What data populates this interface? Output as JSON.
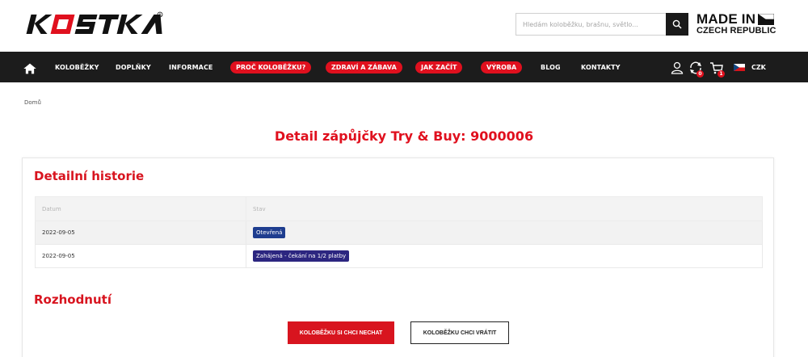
{
  "header": {
    "logo_text": "KOSTKA",
    "search": {
      "placeholder": "Hledám koloběžku, brašnu, světlo..."
    },
    "made_in": {
      "line1": "MADE IN",
      "line2": "CZECH REPUBLIC"
    }
  },
  "nav": {
    "items": [
      "KOLOBĚŽKY",
      "DOPLŇKY",
      "INFORMACE"
    ],
    "pills": [
      "PROČ KOLOBĚŽKU?",
      "ZDRAVÍ A ZÁBAVA",
      "JAK ZAČÍT",
      "VÝROBA"
    ],
    "items2": [
      "BLOG",
      "KONTAKTY"
    ],
    "compare_count": "0",
    "cart_count": "1",
    "currency": "CZK",
    "colors": {
      "bar": "#1c1c1c",
      "pill": "#e0101e"
    }
  },
  "breadcrumb": {
    "home": "Domů"
  },
  "page_title": "Detail zápůjčky Try & Buy: 9000006",
  "history": {
    "title": "Detailní historie",
    "columns": [
      "Datum",
      "Stav"
    ],
    "rows": [
      {
        "date": "2022-09-05",
        "status": "Otevřená"
      },
      {
        "date": "2022-09-05",
        "status": "Zahájená - čekání na 1/2 platby"
      }
    ]
  },
  "decision": {
    "title": "Rozhodnutí",
    "keep_label": "KOLOBĚŽKU SI CHCI NECHAT",
    "return_label": "KOLOBĚŽKU CHCI VRÁTIT"
  },
  "icons": [
    "home-icon",
    "search-icon",
    "user-icon",
    "compare-icon",
    "cart-icon",
    "czech-flag-icon"
  ]
}
